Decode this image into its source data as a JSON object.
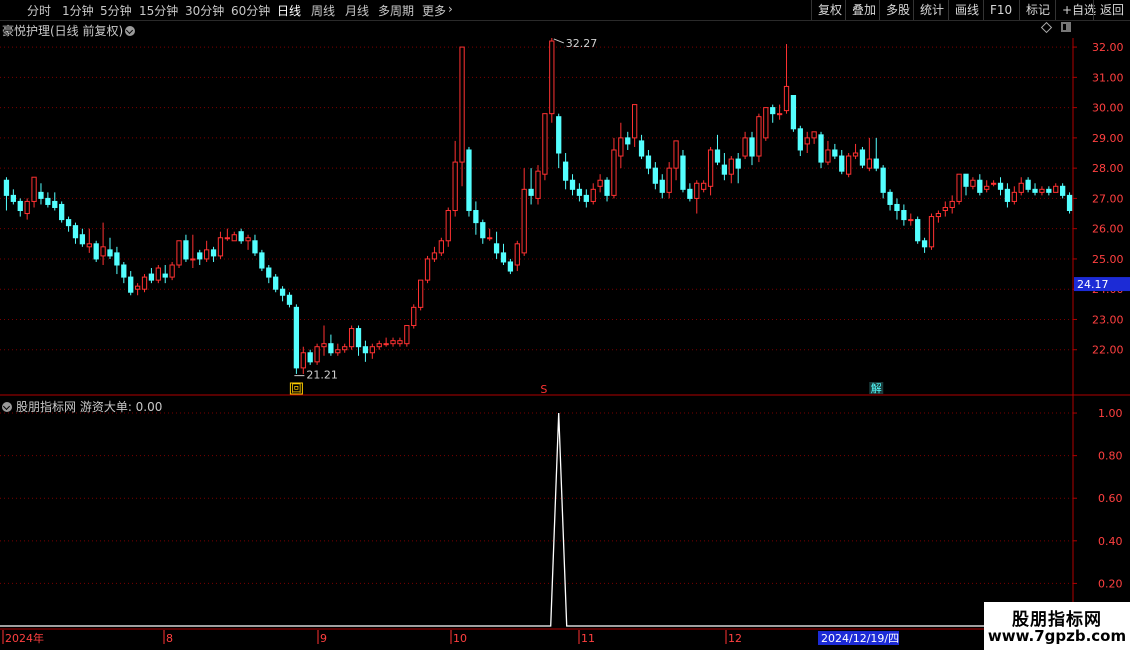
{
  "toolbar": {
    "periods": [
      {
        "label": "分时",
        "active": false
      },
      {
        "label": "1分钟",
        "active": false
      },
      {
        "label": "5分钟",
        "active": false
      },
      {
        "label": "15分钟",
        "active": false
      },
      {
        "label": "30分钟",
        "active": false
      },
      {
        "label": "60分钟",
        "active": false
      },
      {
        "label": "日线",
        "active": true
      },
      {
        "label": "周线",
        "active": false
      },
      {
        "label": "月线",
        "active": false
      },
      {
        "label": "多周期",
        "active": false
      },
      {
        "label": "更多",
        "active": false
      }
    ],
    "actions": [
      "复权",
      "叠加",
      "多股",
      "统计",
      "画线",
      "F10",
      "标记",
      "+自选",
      "返回"
    ]
  },
  "stock_title": "豪悦护理(日线 前复权)",
  "indicator_title": "股朋指标网 游资大单: 0.00",
  "price_tag": "24.17",
  "current_date": "2024/12/19/四",
  "markers": {
    "sq": "回",
    "s": "S",
    "jie": "解"
  },
  "watermark": {
    "title": "股朋指标网",
    "url": "www.7gpzb.com"
  },
  "colors": {
    "up": "#ff3232",
    "down": "#54ffff",
    "grid": "#7a0000",
    "axis": "#b00000"
  },
  "chart_data": [
    {
      "type": "candlestick",
      "title": "豪悦护理(日线 前复权)",
      "y_ticks": [
        22.0,
        23.0,
        24.0,
        25.0,
        26.0,
        27.0,
        28.0,
        29.0,
        30.0,
        31.0,
        32.0
      ],
      "ylim": [
        21.0,
        32.3
      ],
      "annotations": [
        {
          "label": "32.27",
          "value": 32.27
        },
        {
          "label": "21.21",
          "value": 21.21
        }
      ],
      "x_labels": [
        "2024年",
        "8",
        "9",
        "10",
        "11",
        "12"
      ],
      "candles": [
        [
          27.6,
          27.1,
          27.7,
          26.6
        ],
        [
          27.1,
          26.9,
          27.3,
          26.8
        ],
        [
          26.9,
          26.6,
          27.0,
          26.4
        ],
        [
          26.5,
          26.9,
          27.0,
          26.3
        ],
        [
          26.9,
          27.7,
          27.7,
          26.7
        ],
        [
          27.2,
          27.0,
          27.5,
          26.8
        ],
        [
          27.0,
          26.8,
          27.2,
          26.7
        ],
        [
          26.9,
          26.7,
          27.2,
          26.6
        ],
        [
          26.8,
          26.3,
          26.9,
          26.2
        ],
        [
          26.3,
          26.1,
          26.4,
          25.9
        ],
        [
          26.1,
          25.7,
          26.2,
          25.5
        ],
        [
          25.8,
          25.5,
          26.0,
          25.4
        ],
        [
          25.4,
          25.5,
          26.0,
          25.2
        ],
        [
          25.5,
          25.0,
          25.6,
          24.9
        ],
        [
          25.1,
          25.4,
          26.2,
          24.8
        ],
        [
          25.3,
          25.1,
          25.7,
          25.0
        ],
        [
          25.2,
          24.8,
          25.4,
          24.5
        ],
        [
          24.8,
          24.4,
          24.9,
          24.2
        ],
        [
          24.4,
          23.9,
          24.6,
          23.8
        ],
        [
          24.0,
          24.1,
          24.2,
          23.8
        ],
        [
          24.0,
          24.4,
          24.5,
          23.9
        ],
        [
          24.5,
          24.3,
          24.7,
          24.2
        ],
        [
          24.3,
          24.7,
          24.8,
          24.2
        ],
        [
          24.5,
          24.4,
          24.8,
          24.2
        ],
        [
          24.4,
          24.8,
          24.9,
          24.3
        ],
        [
          24.8,
          25.6,
          25.6,
          24.7
        ],
        [
          25.6,
          25.0,
          25.8,
          24.9
        ],
        [
          25.0,
          25.0,
          25.8,
          24.7
        ],
        [
          25.2,
          25.0,
          25.3,
          24.8
        ],
        [
          25.0,
          25.3,
          25.6,
          24.9
        ],
        [
          25.3,
          25.1,
          25.4,
          24.9
        ],
        [
          25.1,
          25.7,
          25.9,
          25.0
        ],
        [
          25.7,
          25.7,
          26.0,
          25.6
        ],
        [
          25.6,
          25.8,
          25.9,
          25.6
        ],
        [
          25.9,
          25.6,
          26.0,
          25.5
        ],
        [
          25.6,
          25.7,
          25.8,
          25.3
        ],
        [
          25.6,
          25.2,
          25.8,
          25.1
        ],
        [
          25.2,
          24.7,
          25.3,
          24.6
        ],
        [
          24.7,
          24.4,
          24.8,
          24.2
        ],
        [
          24.4,
          24.0,
          24.5,
          23.9
        ],
        [
          24.0,
          23.8,
          24.1,
          23.6
        ],
        [
          23.8,
          23.5,
          23.9,
          23.4
        ],
        [
          23.4,
          21.4,
          23.5,
          21.2
        ],
        [
          21.4,
          21.9,
          22.1,
          21.2
        ],
        [
          21.9,
          21.6,
          22.0,
          21.5
        ],
        [
          21.6,
          22.1,
          22.2,
          21.5
        ],
        [
          22.1,
          22.2,
          22.8,
          21.8
        ],
        [
          22.2,
          21.9,
          22.5,
          21.8
        ],
        [
          21.9,
          22.0,
          22.2,
          21.8
        ],
        [
          22.0,
          22.1,
          22.2,
          21.9
        ],
        [
          22.1,
          22.7,
          22.8,
          22.0
        ],
        [
          22.7,
          22.1,
          22.8,
          21.8
        ],
        [
          22.1,
          21.9,
          22.3,
          21.6
        ],
        [
          21.9,
          22.1,
          22.2,
          21.7
        ],
        [
          22.1,
          22.2,
          22.3,
          22.0
        ],
        [
          22.2,
          22.2,
          22.4,
          22.1
        ],
        [
          22.2,
          22.3,
          22.4,
          22.1
        ],
        [
          22.2,
          22.3,
          22.4,
          22.1
        ],
        [
          22.2,
          22.8,
          22.8,
          22.1
        ],
        [
          22.8,
          23.4,
          23.5,
          22.7
        ],
        [
          23.4,
          24.3,
          24.3,
          23.3
        ],
        [
          24.3,
          25.0,
          25.1,
          24.2
        ],
        [
          25.0,
          25.2,
          25.4,
          24.9
        ],
        [
          25.2,
          25.6,
          25.7,
          25.1
        ],
        [
          25.6,
          26.6,
          26.7,
          25.4
        ],
        [
          26.6,
          28.2,
          28.9,
          26.4
        ],
        [
          28.2,
          32.0,
          32.0,
          27.4
        ],
        [
          28.6,
          26.6,
          28.7,
          26.4
        ],
        [
          26.6,
          26.2,
          26.9,
          25.8
        ],
        [
          26.2,
          25.7,
          26.3,
          25.5
        ],
        [
          25.7,
          25.7,
          26.0,
          25.6
        ],
        [
          25.5,
          25.2,
          25.9,
          25.0
        ],
        [
          25.2,
          24.9,
          25.5,
          24.8
        ],
        [
          24.9,
          24.6,
          25.0,
          24.5
        ],
        [
          24.8,
          25.5,
          25.6,
          24.6
        ],
        [
          25.2,
          27.3,
          28.0,
          25.1
        ],
        [
          27.3,
          27.1,
          28.0,
          26.8
        ],
        [
          27.0,
          27.9,
          28.1,
          26.8
        ],
        [
          27.8,
          29.8,
          29.8,
          27.6
        ],
        [
          29.8,
          32.2,
          32.3,
          29.5
        ],
        [
          29.7,
          28.5,
          29.8,
          28.0
        ],
        [
          28.2,
          27.6,
          28.5,
          27.3
        ],
        [
          27.6,
          27.3,
          27.8,
          27.1
        ],
        [
          27.3,
          27.1,
          27.5,
          26.9
        ],
        [
          27.1,
          26.9,
          27.3,
          26.7
        ],
        [
          26.9,
          27.3,
          27.5,
          26.8
        ],
        [
          27.4,
          27.6,
          27.8,
          27.2
        ],
        [
          27.6,
          27.1,
          27.7,
          26.9
        ],
        [
          27.1,
          28.6,
          29.0,
          27.0
        ],
        [
          28.4,
          29.0,
          29.5,
          28.0
        ],
        [
          29.0,
          28.8,
          29.2,
          28.6
        ],
        [
          29.0,
          30.1,
          30.1,
          28.7
        ],
        [
          28.9,
          28.4,
          29.1,
          28.3
        ],
        [
          28.4,
          28.0,
          28.6,
          27.8
        ],
        [
          28.0,
          27.5,
          28.2,
          27.3
        ],
        [
          27.6,
          27.2,
          27.8,
          27.0
        ],
        [
          27.2,
          28.0,
          28.2,
          27.0
        ],
        [
          28.0,
          28.9,
          28.9,
          27.6
        ],
        [
          28.4,
          27.3,
          28.6,
          27.2
        ],
        [
          27.3,
          27.0,
          27.5,
          26.9
        ],
        [
          27.0,
          27.5,
          27.6,
          26.5
        ],
        [
          27.3,
          27.5,
          27.6,
          27.2
        ],
        [
          27.4,
          28.6,
          28.7,
          27.1
        ],
        [
          28.6,
          28.2,
          29.1,
          28.1
        ],
        [
          28.1,
          27.8,
          28.5,
          27.6
        ],
        [
          27.8,
          28.3,
          28.4,
          27.5
        ],
        [
          28.3,
          28.0,
          28.5,
          27.5
        ],
        [
          28.4,
          29.0,
          29.2,
          28.3
        ],
        [
          29.0,
          28.4,
          29.2,
          28.1
        ],
        [
          28.4,
          29.7,
          29.8,
          28.2
        ],
        [
          29.0,
          30.0,
          30.0,
          28.9
        ],
        [
          30.0,
          29.8,
          30.1,
          29.5
        ],
        [
          29.8,
          29.8,
          30.1,
          29.6
        ],
        [
          29.9,
          30.7,
          32.1,
          29.8
        ],
        [
          30.4,
          29.3,
          30.4,
          29.2
        ],
        [
          29.3,
          28.6,
          29.4,
          28.4
        ],
        [
          28.8,
          29.0,
          29.2,
          28.5
        ],
        [
          29.0,
          29.2,
          29.2,
          28.8
        ],
        [
          29.1,
          28.2,
          29.2,
          28.0
        ],
        [
          28.2,
          28.6,
          28.9,
          28.1
        ],
        [
          28.6,
          28.4,
          28.8,
          28.3
        ],
        [
          28.4,
          27.9,
          28.6,
          27.8
        ],
        [
          27.8,
          28.4,
          28.5,
          27.7
        ],
        [
          28.4,
          28.5,
          28.8,
          28.3
        ],
        [
          28.6,
          28.1,
          28.7,
          28.0
        ],
        [
          28.0,
          28.3,
          29.0,
          27.9
        ],
        [
          28.3,
          28.0,
          29.0,
          27.9
        ],
        [
          28.0,
          27.2,
          28.1,
          27.0
        ],
        [
          27.2,
          26.8,
          27.3,
          26.6
        ],
        [
          26.8,
          26.6,
          27.0,
          26.3
        ],
        [
          26.6,
          26.3,
          26.8,
          26.1
        ],
        [
          26.3,
          26.3,
          26.5,
          26.1
        ],
        [
          26.3,
          25.6,
          26.4,
          25.5
        ],
        [
          25.6,
          25.4,
          25.7,
          25.2
        ],
        [
          25.4,
          26.4,
          26.5,
          25.3
        ],
        [
          26.4,
          26.5,
          26.6,
          26.2
        ],
        [
          26.6,
          26.7,
          26.9,
          26.4
        ],
        [
          26.7,
          26.9,
          27.1,
          26.5
        ],
        [
          26.9,
          27.8,
          27.8,
          26.8
        ],
        [
          27.8,
          27.4,
          27.8,
          27.1
        ],
        [
          27.4,
          27.6,
          27.7,
          27.3
        ],
        [
          27.6,
          27.2,
          27.8,
          27.1
        ],
        [
          27.3,
          27.4,
          27.6,
          27.2
        ],
        [
          27.5,
          27.5,
          27.6,
          27.4
        ],
        [
          27.5,
          27.3,
          27.7,
          27.1
        ],
        [
          27.3,
          26.9,
          27.5,
          26.7
        ],
        [
          26.9,
          27.2,
          27.4,
          26.8
        ],
        [
          27.2,
          27.5,
          27.7,
          27.1
        ],
        [
          27.6,
          27.3,
          27.7,
          27.2
        ],
        [
          27.3,
          27.2,
          27.5,
          27.1
        ],
        [
          27.2,
          27.3,
          27.4,
          27.1
        ],
        [
          27.3,
          27.2,
          27.4,
          27.1
        ],
        [
          27.2,
          27.4,
          27.5,
          27.2
        ],
        [
          27.4,
          27.1,
          27.5,
          27.0
        ],
        [
          27.1,
          26.6,
          27.2,
          26.5
        ]
      ]
    },
    {
      "type": "line",
      "title": "游资大单",
      "y_ticks": [
        0.2,
        0.4,
        0.6,
        0.8,
        1.0
      ],
      "ylim": [
        0,
        1.08
      ],
      "spike_index": 80,
      "spike_value": 1.0
    }
  ]
}
